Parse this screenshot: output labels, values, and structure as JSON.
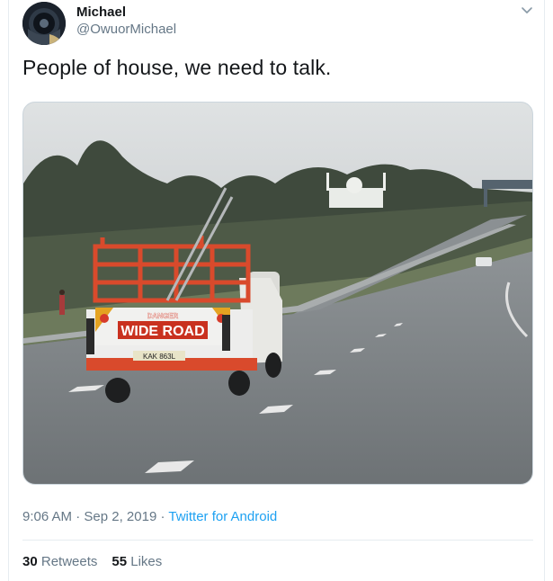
{
  "author": {
    "name": "Michael",
    "handle": "@OwuorMichael"
  },
  "tweet": {
    "text": "People of house, we need to talk.",
    "time": "9:06 AM",
    "separator": " · ",
    "date": "Sep 2, 2019",
    "source": "Twitter for Android"
  },
  "photo": {
    "sign_top": "DANGER",
    "sign_main": "WIDE ROAD",
    "plate": "KAK 863L"
  },
  "stats": {
    "retweets_count": "30",
    "retweets_label": "Retweets",
    "likes_count": "55",
    "likes_label": "Likes"
  },
  "icons": {
    "menu": "chevron-down-icon"
  },
  "colors": {
    "link": "#1da1f2",
    "secondary_text": "#657786",
    "primary_text": "#14171a",
    "divider": "#e6ecf0"
  }
}
